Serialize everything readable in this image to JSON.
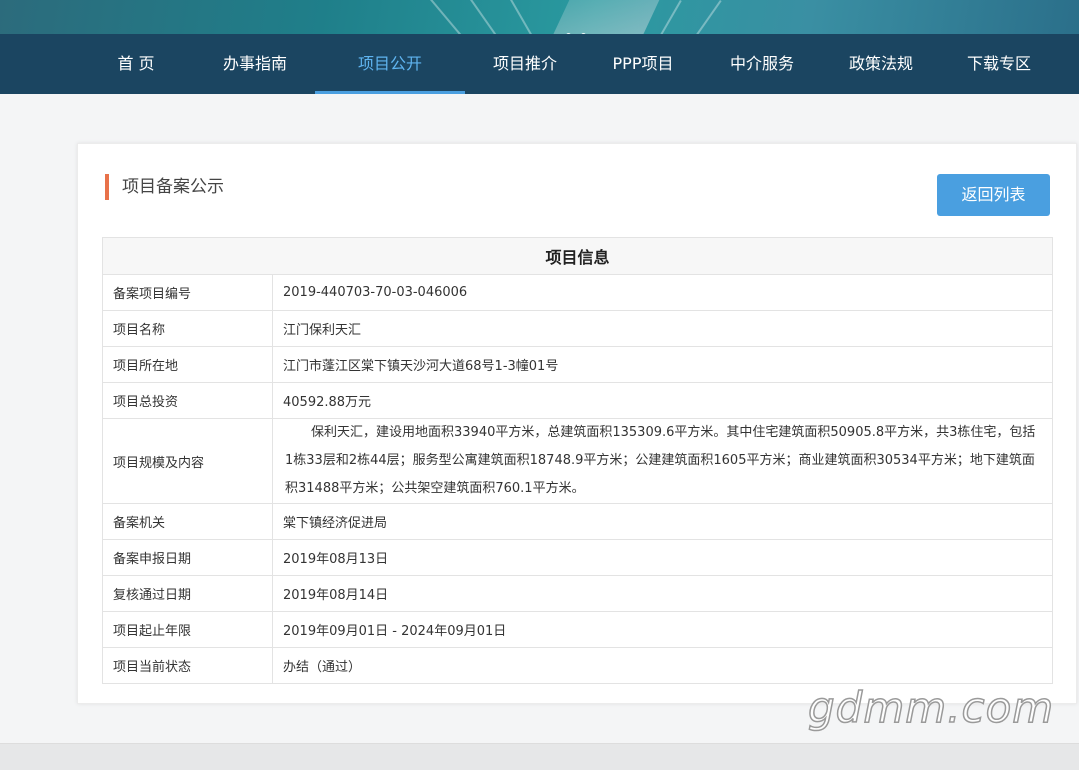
{
  "nav": {
    "items": [
      {
        "label": "首 页"
      },
      {
        "label": "办事指南"
      },
      {
        "label": "项目公开"
      },
      {
        "label": "项目推介"
      },
      {
        "label": "PPP项目"
      },
      {
        "label": "中介服务"
      },
      {
        "label": "政策法规"
      },
      {
        "label": "下载专区"
      }
    ],
    "active": "项目公开",
    "active_color": "#5fb4f0"
  },
  "card": {
    "title": "项目备案公示",
    "back_button": "返回列表",
    "accent_color": "#e8724a",
    "button_color": "#4a9fe0"
  },
  "table": {
    "header": "项目信息",
    "rows": [
      {
        "label": "备案项目编号",
        "value": "2019-440703-70-03-046006"
      },
      {
        "label": "项目名称",
        "value": "江门保利天汇"
      },
      {
        "label": "项目所在地",
        "value": "江门市蓬江区棠下镇天沙河大道68号1-3幢01号"
      },
      {
        "label": "项目总投资",
        "value": "40592.88万元"
      },
      {
        "label": "项目规模及内容",
        "value": "保利天汇，建设用地面积33940平方米，总建筑面积135309.6平方米。其中住宅建筑面积50905.8平方米，共3栋住宅，包括1栋33层和2栋44层；服务型公寓建筑面积18748.9平方米；公建建筑面积1605平方米；商业建筑面积30534平方米；地下建筑面积31488平方米；公共架空建筑面积760.1平方米。"
      },
      {
        "label": "备案机关",
        "value": "棠下镇经济促进局"
      },
      {
        "label": "备案申报日期",
        "value": "2019年08月13日"
      },
      {
        "label": "复核通过日期",
        "value": "2019年08月14日"
      },
      {
        "label": "项目起止年限",
        "value": "2019年09月01日 - 2024年09月01日"
      },
      {
        "label": "项目当前状态",
        "value": "办结（通过）"
      }
    ]
  },
  "watermark": "gdmm.com"
}
